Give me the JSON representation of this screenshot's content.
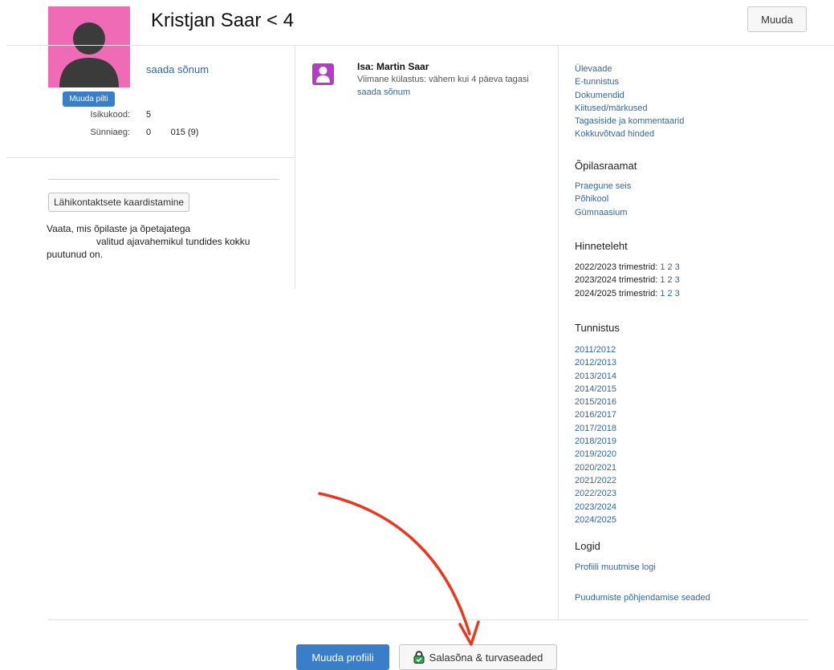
{
  "header": {
    "title": "Kristjan Saar < 4",
    "edit_button": "Muuda"
  },
  "profile": {
    "change_picture": "Muuda pilti",
    "send_message": "saada sõnum",
    "id_label": "Isikukood:",
    "id_value": "5",
    "birth_label": "Sünniaeg:",
    "birth_value": "0        015 (9)",
    "avatar_color": "#f06bb6"
  },
  "contacts": {
    "button": "Lähikontaktsete kaardistamine",
    "description_1": "Vaata, mis õpilaste ja õpetajatega",
    "description_2": "valitud ajavahemikul tundides kokku",
    "description_3": "puutunud on."
  },
  "parent": {
    "name": "Isa: Martin Saar",
    "last_visit": "Viimane külastus: vähem kui 4 päeva tagasi",
    "send_message": "saada sõnum",
    "icon_color": "#b23ec4"
  },
  "nav": {
    "items": [
      "Ülevaade",
      "E-tunnistus",
      "Dokumendid",
      "Kiitused/märkused",
      "Tagasiside ja kommentaarid",
      "Kokkuvõtvad hinded"
    ]
  },
  "opilasraamat": {
    "heading": "Õpilasraamat",
    "items": [
      "Praegune seis",
      "Põhikool",
      "Gümnaasium"
    ]
  },
  "hinneteleht": {
    "heading": "Hinneteleht",
    "rows": [
      {
        "label": "2022/2023 trimestrid:",
        "terms": [
          "1",
          "2",
          "3"
        ]
      },
      {
        "label": "2023/2024 trimestrid:",
        "terms": [
          "1",
          "2",
          "3"
        ]
      },
      {
        "label": "2024/2025 trimestrid:",
        "terms": [
          "1",
          "2",
          "3"
        ]
      }
    ]
  },
  "tunnistus": {
    "heading": "Tunnistus",
    "years": [
      "2011/2012",
      "2012/2013",
      "2013/2014",
      "2014/2015",
      "2015/2016",
      "2016/2017",
      "2017/2018",
      "2018/2019",
      "2019/2020",
      "2020/2021",
      "2021/2022",
      "2022/2023",
      "2023/2024",
      "2024/2025"
    ]
  },
  "logid": {
    "heading": "Logid",
    "profile_log": "Profiili muutmise logi",
    "absence_settings": "Puudumiste põhjendamise seaded"
  },
  "footer": {
    "edit_profile": "Muuda profiili",
    "password_security": "Salasõna & turvaseaded"
  },
  "colors": {
    "link": "#35689b",
    "primary_button": "#3a7dc9",
    "annotation_arrow": "#e8391f",
    "lock_icon": "#2aa84a"
  }
}
